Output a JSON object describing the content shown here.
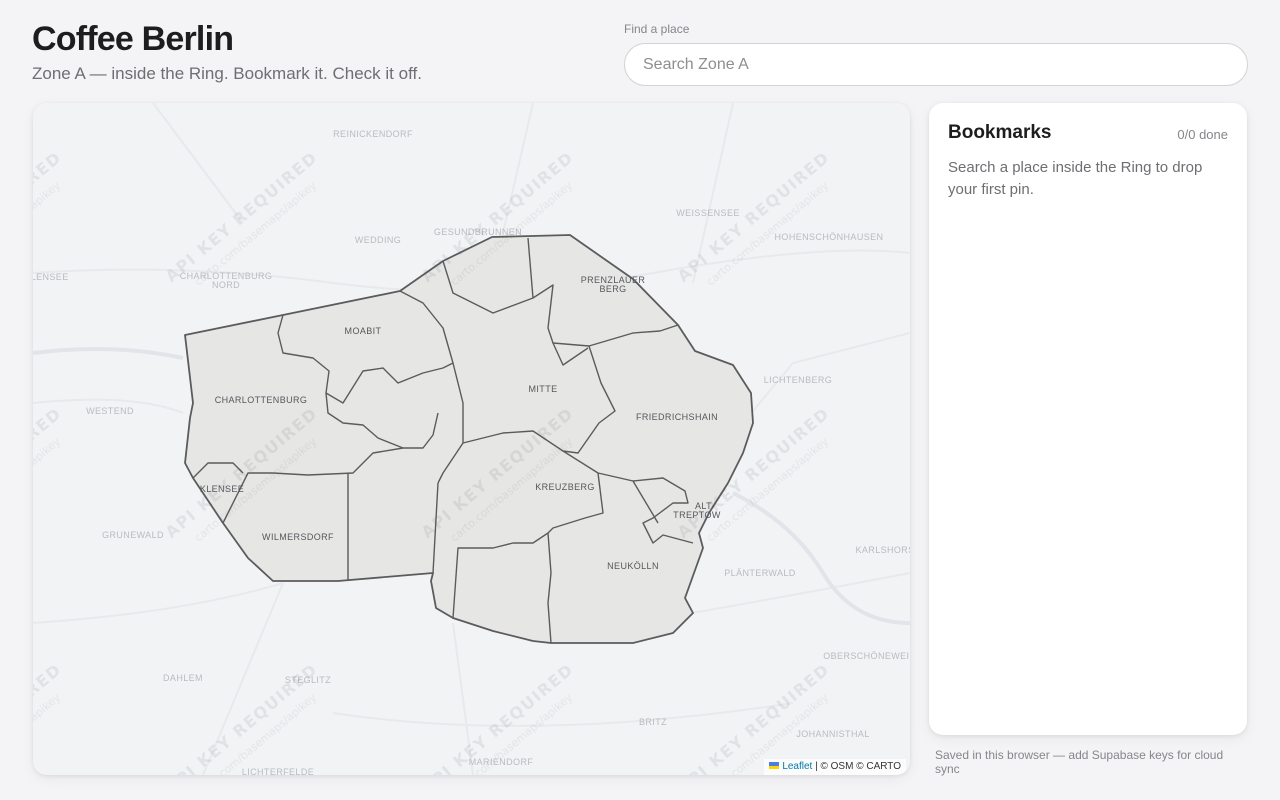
{
  "header": {
    "title": "Coffee Berlin",
    "subtitle": "Zone A — inside the Ring. Bookmark it. Check it off."
  },
  "search": {
    "label": "Find a place",
    "placeholder": "Search Zone A",
    "value": ""
  },
  "map": {
    "district_labels": [
      "MOABIT",
      "PRENZLAUER",
      "BERG",
      "MITTE",
      "FRIEDRICHSHAIN",
      "CHARLOTTENBURG",
      "KREUZBERG",
      "ALT-",
      "TREPTOW",
      "NEUKÖLLN",
      "WILMERSDORF",
      "KLENSEE"
    ],
    "outer_labels": [
      "REINICKENDORF",
      "GESUNDBRUNNEN",
      "WEDDING",
      "WEISSENSEE",
      "HOHENSCHÖNHAUSEN",
      "CHARLOTTENBURG",
      "NORD",
      "LICHTENBERG",
      "WESTEND",
      "GRUNEWALD",
      "KARLSHORST",
      "PLÄNTERWALD",
      "DAHLEM",
      "STEGLITZ",
      "BRITZ",
      "JOHANNISTHAL",
      "OBERSCHÖNEWEIDE",
      "MARIENDORF",
      "LICHTERFELDE",
      "HALENSEE"
    ],
    "watermark_title": "API KEY REQUIRED",
    "watermark_url": "carto.com/basemaps/apikey",
    "attribution": {
      "leaflet": "Leaflet",
      "rest": "| © OSM © CARTO"
    },
    "colors": {
      "zone_fill": "#e6e6e4",
      "zone_outline": "#5b5b5e",
      "background": "#f2f3f5"
    }
  },
  "bookmarks": {
    "title": "Bookmarks",
    "count": "0/0 done",
    "empty_message": "Search a place inside the Ring to drop your first pin."
  },
  "footer": {
    "note": "Saved in this browser — add Supabase keys for cloud sync"
  }
}
